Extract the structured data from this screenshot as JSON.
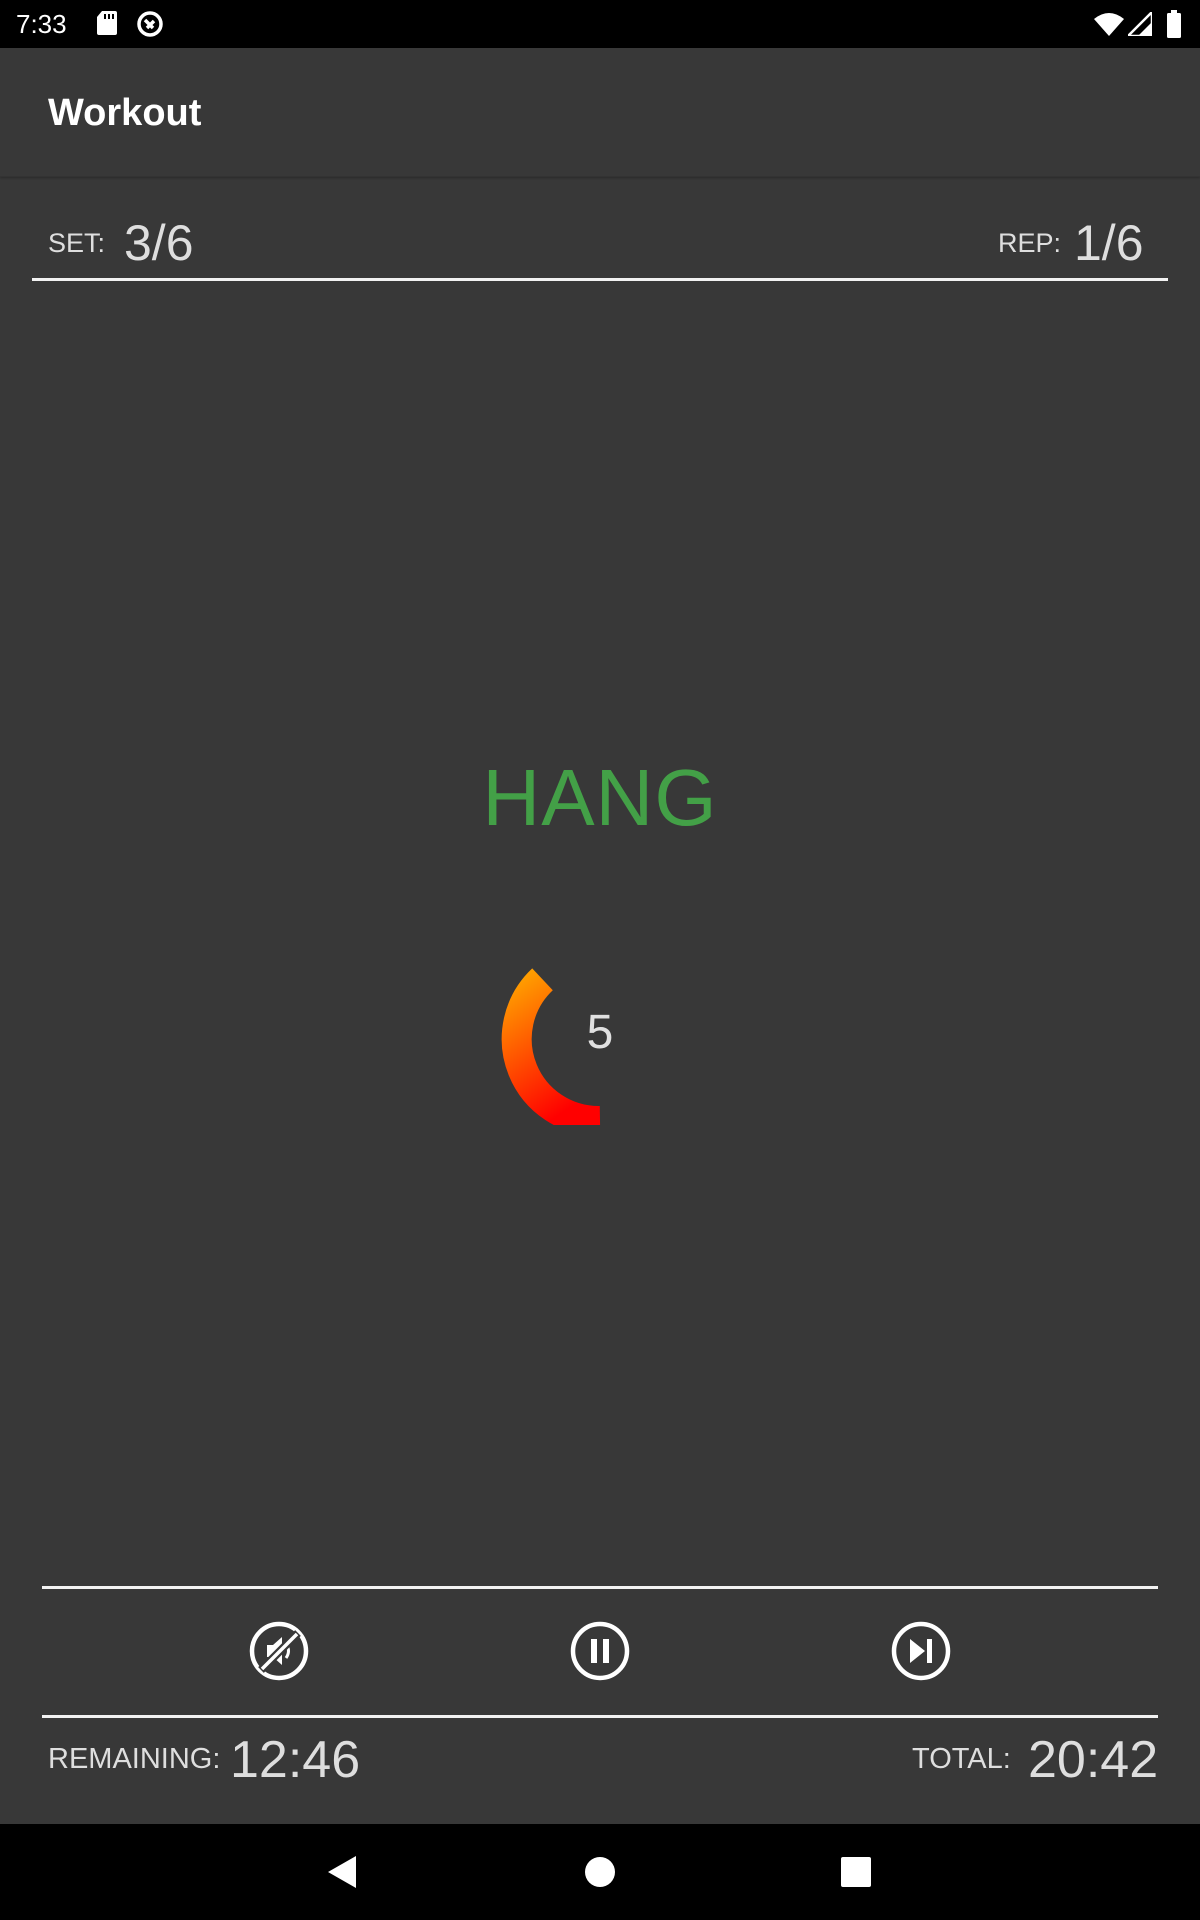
{
  "status_bar": {
    "time": "7:33",
    "left_icons": [
      "sd-card-icon",
      "sync-disabled-icon"
    ],
    "right_icons": [
      "wifi-icon",
      "cell-signal-icon",
      "battery-icon"
    ]
  },
  "app_bar": {
    "title": "Workout"
  },
  "counters": {
    "set_label": "SET:",
    "set_value": "3/6",
    "rep_label": "REP:",
    "rep_value": "1/6"
  },
  "phase": {
    "label": "HANG",
    "color": "#43a047"
  },
  "timer": {
    "value": "5",
    "gradient_start": "#ffa000",
    "gradient_end": "#ff0000"
  },
  "controls": {
    "buttons": [
      "mute-icon",
      "pause-icon",
      "skip-next-icon"
    ]
  },
  "stats": {
    "remaining_label": "REMAINING:",
    "remaining_value": "12:46",
    "total_label": "TOTAL:",
    "total_value": "20:42"
  },
  "nav_bar": {
    "buttons": [
      "back-icon",
      "home-icon",
      "recents-icon"
    ]
  }
}
